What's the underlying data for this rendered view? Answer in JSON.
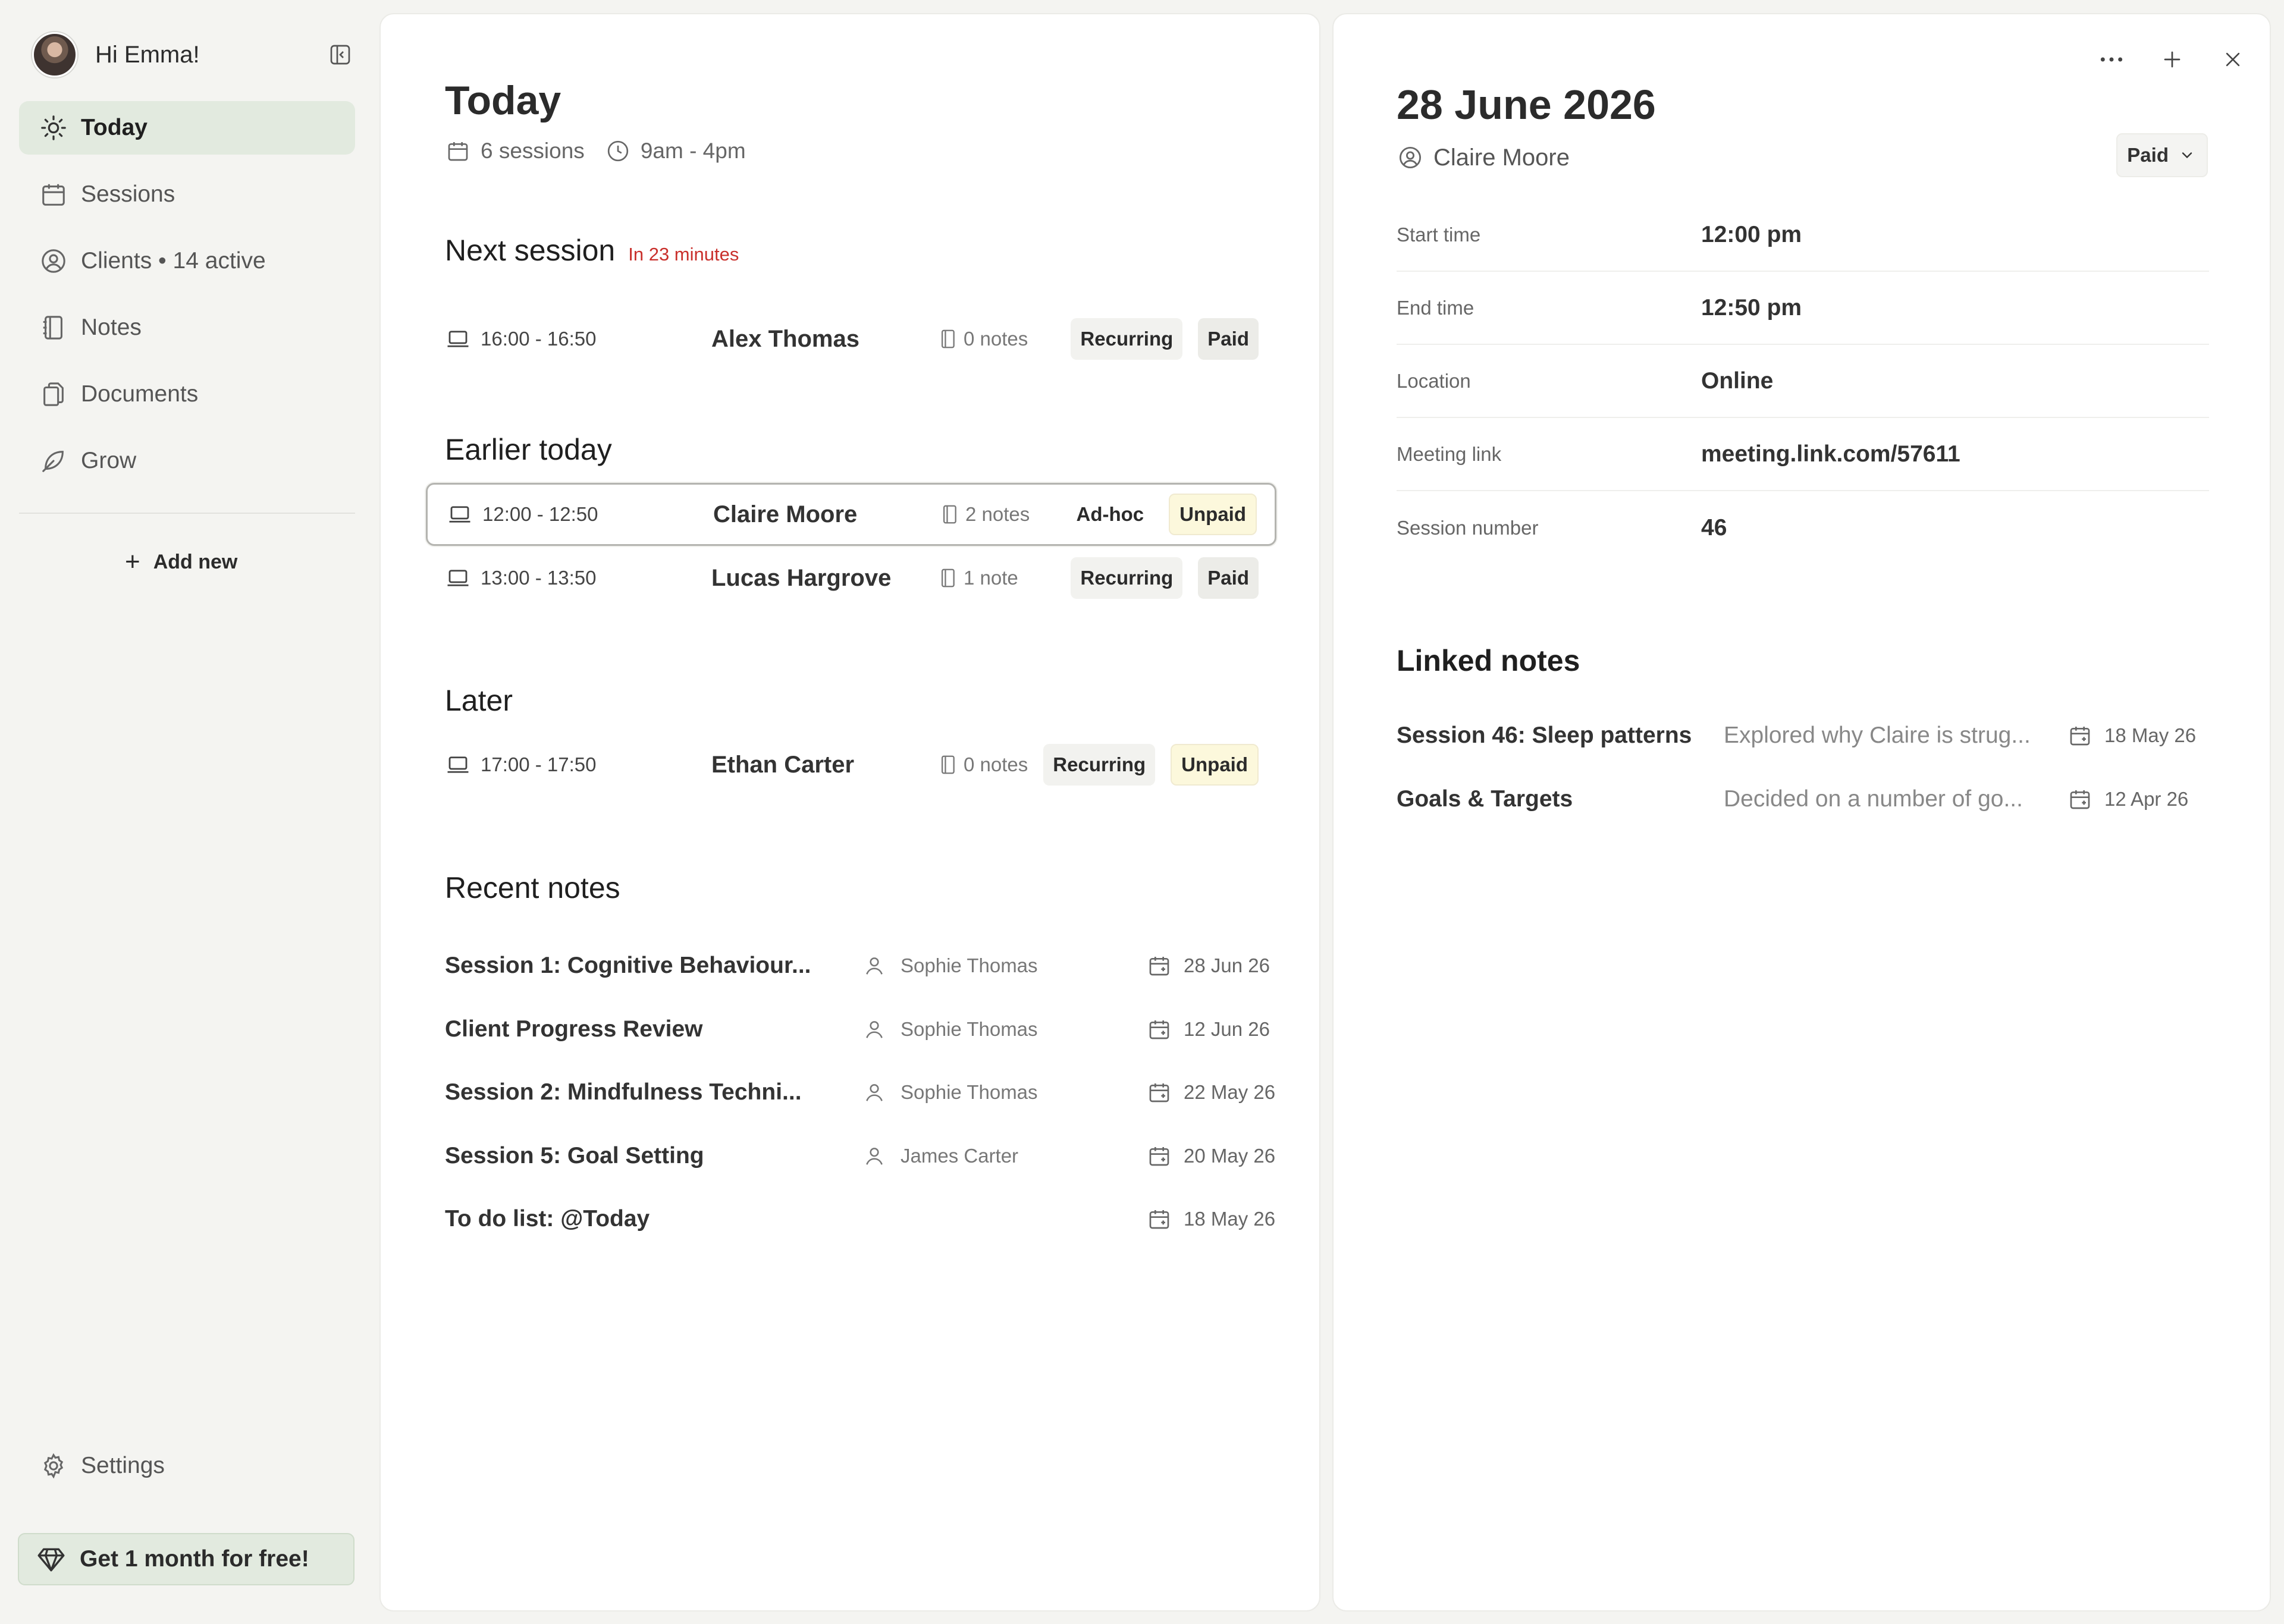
{
  "sidebar": {
    "greeting": "Hi Emma!",
    "nav": [
      {
        "label": "Today",
        "icon": "sun-icon",
        "active": true
      },
      {
        "label": "Sessions",
        "icon": "calendar-icon"
      },
      {
        "label": "Clients • 14 active",
        "icon": "user-circle-icon"
      },
      {
        "label": "Notes",
        "icon": "notebook-icon"
      },
      {
        "label": "Documents",
        "icon": "documents-icon"
      },
      {
        "label": "Grow",
        "icon": "leaf-icon"
      }
    ],
    "add_new": "Add new",
    "settings": "Settings",
    "promo": "Get 1 month for free!"
  },
  "main": {
    "title": "Today",
    "sessions_count": "6 sessions",
    "hours": "9am - 4pm",
    "next_session": {
      "heading": "Next session",
      "countdown": "In 23 minutes",
      "rows": [
        {
          "time": "16:00 - 16:50",
          "client": "Alex Thomas",
          "notes": "0 notes",
          "type": "Recurring",
          "payment": "Paid"
        }
      ]
    },
    "earlier": {
      "heading": "Earlier today",
      "rows": [
        {
          "time": "12:00 - 12:50",
          "client": "Claire Moore",
          "notes": "2 notes",
          "type": "Ad-hoc",
          "payment": "Unpaid",
          "selected": true
        },
        {
          "time": "13:00 - 13:50",
          "client": "Lucas Hargrove",
          "notes": "1 note",
          "type": "Recurring",
          "payment": "Paid"
        }
      ]
    },
    "later": {
      "heading": "Later",
      "rows": [
        {
          "time": "17:00 - 17:50",
          "client": "Ethan Carter",
          "notes": "0 notes",
          "type": "Recurring",
          "payment": "Unpaid"
        }
      ]
    },
    "recent_notes": {
      "heading": "Recent notes",
      "rows": [
        {
          "title": "Session 1: Cognitive Behaviour...",
          "person": "Sophie Thomas",
          "date": "28 Jun 26"
        },
        {
          "title": "Client Progress Review",
          "person": "Sophie Thomas",
          "date": "12 Jun 26"
        },
        {
          "title": "Session 2: Mindfulness Techni...",
          "person": "Sophie Thomas",
          "date": "22 May 26"
        },
        {
          "title": "Session 5: Goal Setting",
          "person": "James Carter",
          "date": "20 May 26"
        },
        {
          "title": "To do list: @Today",
          "person": "",
          "date": "18 May 26"
        }
      ]
    }
  },
  "detail": {
    "date": "28 June 2026",
    "client": "Claire Moore",
    "status": "Paid",
    "fields": [
      {
        "label": "Start time",
        "value": "12:00 pm"
      },
      {
        "label": "End time",
        "value": "12:50 pm"
      },
      {
        "label": "Location",
        "value": "Online"
      },
      {
        "label": "Meeting link",
        "value": "meeting.link.com/57611"
      },
      {
        "label": "Session number",
        "value": "46"
      }
    ],
    "linked_heading": "Linked notes",
    "linked": [
      {
        "title": "Session 46: Sleep patterns",
        "excerpt": "Explored why Claire is strug...",
        "date": "18 May 26"
      },
      {
        "title": "Goals & Targets",
        "excerpt": "Decided on a number of go...",
        "date": "12 Apr 26"
      }
    ]
  },
  "colors": {
    "accent_bg": "#e2eadf",
    "countdown": "#c9302c",
    "unpaid_bg": "#fcf8dc"
  }
}
